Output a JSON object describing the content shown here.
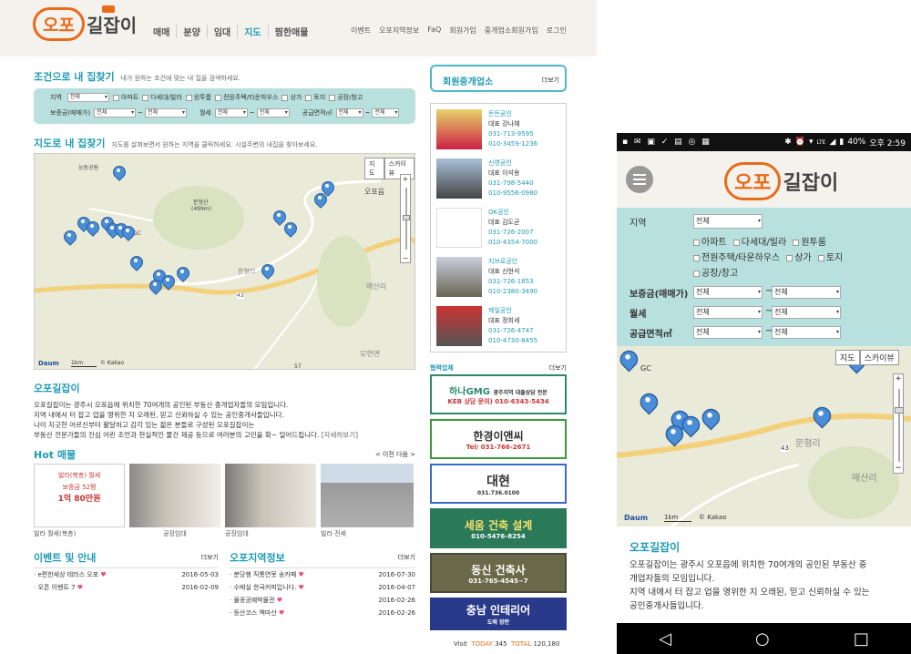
{
  "logo": {
    "circle": "오포",
    "rest": "길잡이"
  },
  "mainnav": [
    "매매",
    "분양",
    "임대",
    "지도",
    "찜한매물"
  ],
  "subnav": [
    "이벤트",
    "오포지역정보",
    "FaQ",
    "회원가입",
    "중개업소회원가입",
    "로그인"
  ],
  "search": {
    "title": "조건으로 내 집찾기",
    "desc": "내가 원하는 조건에 맞는 내 집을 검색하세요.",
    "region_label": "지역",
    "all": "전체",
    "tilde": "~",
    "types": [
      "아파트",
      "다세대/빌라",
      "원투룸",
      "전원주택/타운하우스",
      "상가",
      "토지",
      "공장/창고"
    ],
    "deposit_label": "보증금(매매가)",
    "monthly_label": "월세",
    "area_label": "공급면적㎡"
  },
  "mapsec": {
    "title": "지도로 내 집찾기",
    "desc": "지도를 살펴보면서 원하는 지역을 클릭하세요. 시설주변의 내집을 찾아보세요.",
    "map_btn": "지도",
    "sky_btn": "스카이뷰",
    "scale": "1km",
    "copy": "© Kakao",
    "daum": "Daum",
    "places": [
      "능동공원",
      "문형산",
      "(499m)",
      "오포읍",
      "매산리",
      "문형리",
      "GC",
      "43",
      "57",
      "모현면"
    ]
  },
  "about": {
    "title": "오포길잡이",
    "lines": [
      "오포길잡이는 광주시 오포읍에 위치한 70여개의 공인된 부동산 중개업자들의 모임입니다.",
      "지역 내에서 터 잡고 업을 영위한 지 오래된, 믿고 신뢰하실 수 있는 공인중개사들입니다.",
      "나이 지긋한 어르신부터 활달하고 감각 있는 젊은 분들로 구성된 오포길잡이는",
      "부동산 전문가들의 진심 어린 조언과 현실적인 물건 제공 등으로 여러분의 고민을 확~ 덜어드립니다."
    ],
    "more": "[자세히보기]"
  },
  "hot": {
    "title": "Hot 매물",
    "nav": "< 이전 다음 >",
    "items": [
      "빌라 월세(복층)",
      "공장임대",
      "공장임대",
      "빌라 전세"
    ],
    "promo": [
      "빌라(복층) 월세",
      "보증금 52평",
      "1억 80만원"
    ]
  },
  "events": {
    "title": "이벤트 및 안내",
    "more": "더보기",
    "items": [
      {
        "t": "e편한세상 테라스 오포",
        "d": "2016-05-03"
      },
      {
        "t": "오픈 이벤트 7",
        "d": "2016-02-09"
      }
    ]
  },
  "local": {
    "title": "오포지역정보",
    "more": "더보기",
    "items": [
      {
        "t": "분당행 직통연못 송카페",
        "d": "2016-07-30"
      },
      {
        "t": "수배실 한국커피입니다.",
        "d": "2016-04-07"
      },
      {
        "t": "물꽁공예박물관",
        "d": "2016-02-26"
      },
      {
        "t": "등산코스 백마산",
        "d": "2016-02-26"
      }
    ]
  },
  "side": {
    "members_title": "회원중개업소",
    "more": "더보기",
    "agents": [
      {
        "name": "든든공인",
        "rep": "대표 강나혜",
        "p1": "031-713-9595",
        "p2": "010-3459-1236"
      },
      {
        "name": "신영공인",
        "rep": "대표 이석용",
        "p1": "031-798-5440",
        "p2": "010-9556-0980"
      },
      {
        "name": "OK공인",
        "rep": "대표 김도균",
        "p1": "031-726-2007",
        "p2": "010-4354-7000"
      },
      {
        "name": "지브로공인",
        "rep": "대표 신현석",
        "p1": "031-726-1853",
        "p2": "010-2380-3490"
      },
      {
        "name": "제일공인",
        "rep": "대표 정회세",
        "p1": "031-726-4747",
        "p2": "010-4730-8455"
      }
    ],
    "partner_title": "협력업체",
    "banners": [
      {
        "a": "하나GMG",
        "b": "광주지역 대출상담 전문",
        "c": "KEB 상담 문의) 010-6343-5434"
      },
      {
        "a": "한경이앤씨",
        "b": "Tel/ 031-766-2671"
      },
      {
        "a": "대현",
        "b": "031.736.0100"
      },
      {
        "a": "세움 건축 설계",
        "b": "010-5476-8254"
      },
      {
        "a": "동신 건축사",
        "b": "031-765-4545~7"
      },
      {
        "a": "충남 인테리어",
        "b": "도배 장판"
      }
    ],
    "visit": "Visit",
    "today_label": "TODAY",
    "today": "345",
    "total_label": "TOTAL",
    "total": "120,180"
  },
  "mobile": {
    "status_left": "40%",
    "time": "오후 2:59",
    "lte": "LTE",
    "region": "지역",
    "all": "전체",
    "types": [
      "아파트",
      "다세대/빌라",
      "원투룸",
      "전원주택/타운하우스",
      "상가",
      "토지",
      "공장/창고"
    ],
    "deposit": "보증금(매매가)",
    "monthly": "월세",
    "area": "공급면적㎡",
    "tilde": "~",
    "map_btn": "지도",
    "sky_btn": "스카이뷰",
    "scale": "1km",
    "copy": "© Kakao",
    "places": [
      "GC",
      "문형리",
      "43",
      "매산리"
    ],
    "about_title": "오포길잡이",
    "about_lines": [
      "오포길잡이는 광주시 오포읍에 위치한 70여개의 공인된 부동산 중",
      "개업자들의 모임입니다.",
      "지역 내에서 터 잡고 업을 영위한 지 오래된, 믿고 신뢰하실 수 있는",
      "공인중개사들입니다."
    ]
  },
  "colors": {
    "accent": "#1e9bb5",
    "brand": "#e86b1a",
    "search_bg": "#b7e0de"
  }
}
